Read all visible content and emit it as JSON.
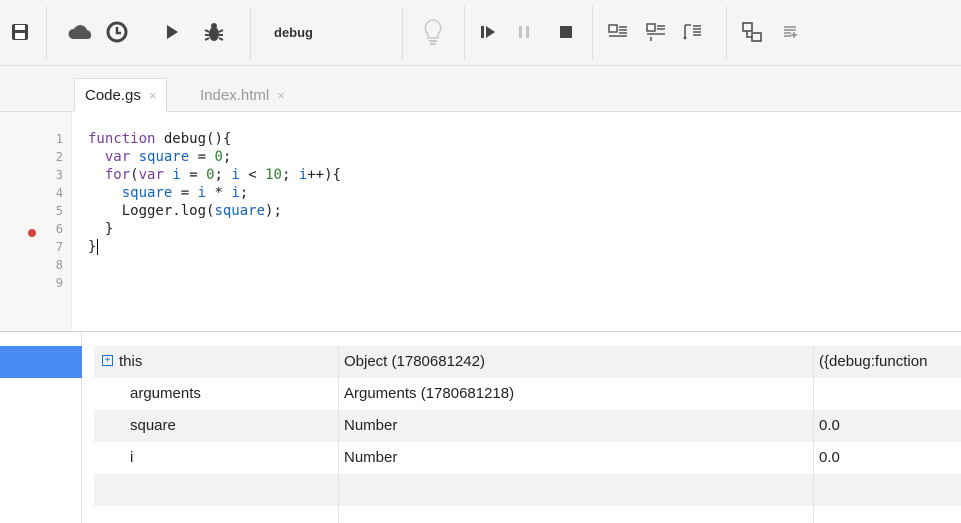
{
  "toolbar": {
    "function_name": "debug",
    "icons": [
      "save-icon",
      "cloud-icon",
      "clock-icon",
      "run-icon",
      "debug-bug-icon",
      "lightbulb-icon",
      "continue-icon",
      "pause-icon",
      "stop-icon",
      "step-into-icon",
      "step-over-icon",
      "step-out-icon",
      "breakpoints-icon",
      "add-watch-icon"
    ]
  },
  "tabs": [
    {
      "label": "Code.gs",
      "close": "×",
      "active": true
    },
    {
      "label": "Index.html",
      "close": "×",
      "active": false
    }
  ],
  "editor": {
    "line_numbers": [
      "1",
      "2",
      "3",
      "4",
      "5",
      "6",
      "7",
      "8",
      "9"
    ],
    "breakpoint_line": "5",
    "code": [
      "function debug(){",
      "  var square = 0;",
      "  for(var i = 0; i < 10; i++){",
      "    square = i * i;",
      "    Logger.log(square);",
      "  }",
      "}"
    ]
  },
  "debugger": {
    "expand_symbol": "+",
    "variables": [
      {
        "name": "this",
        "type": "Object (1780681242)",
        "value": "({debug:function",
        "expandable": true
      },
      {
        "name": "arguments",
        "type": "Arguments (1780681218)",
        "value": "",
        "expandable": false
      },
      {
        "name": "square",
        "type": "Number",
        "value": "0.0",
        "expandable": false
      },
      {
        "name": "i",
        "type": "Number",
        "value": "0.0",
        "expandable": false
      }
    ]
  },
  "colors": {
    "breakpoint": "#d9433b",
    "selected_frame": "#4a8af4",
    "keyword": "#7a3e9d",
    "variable": "#1565c0",
    "number": "#2e7d32"
  }
}
